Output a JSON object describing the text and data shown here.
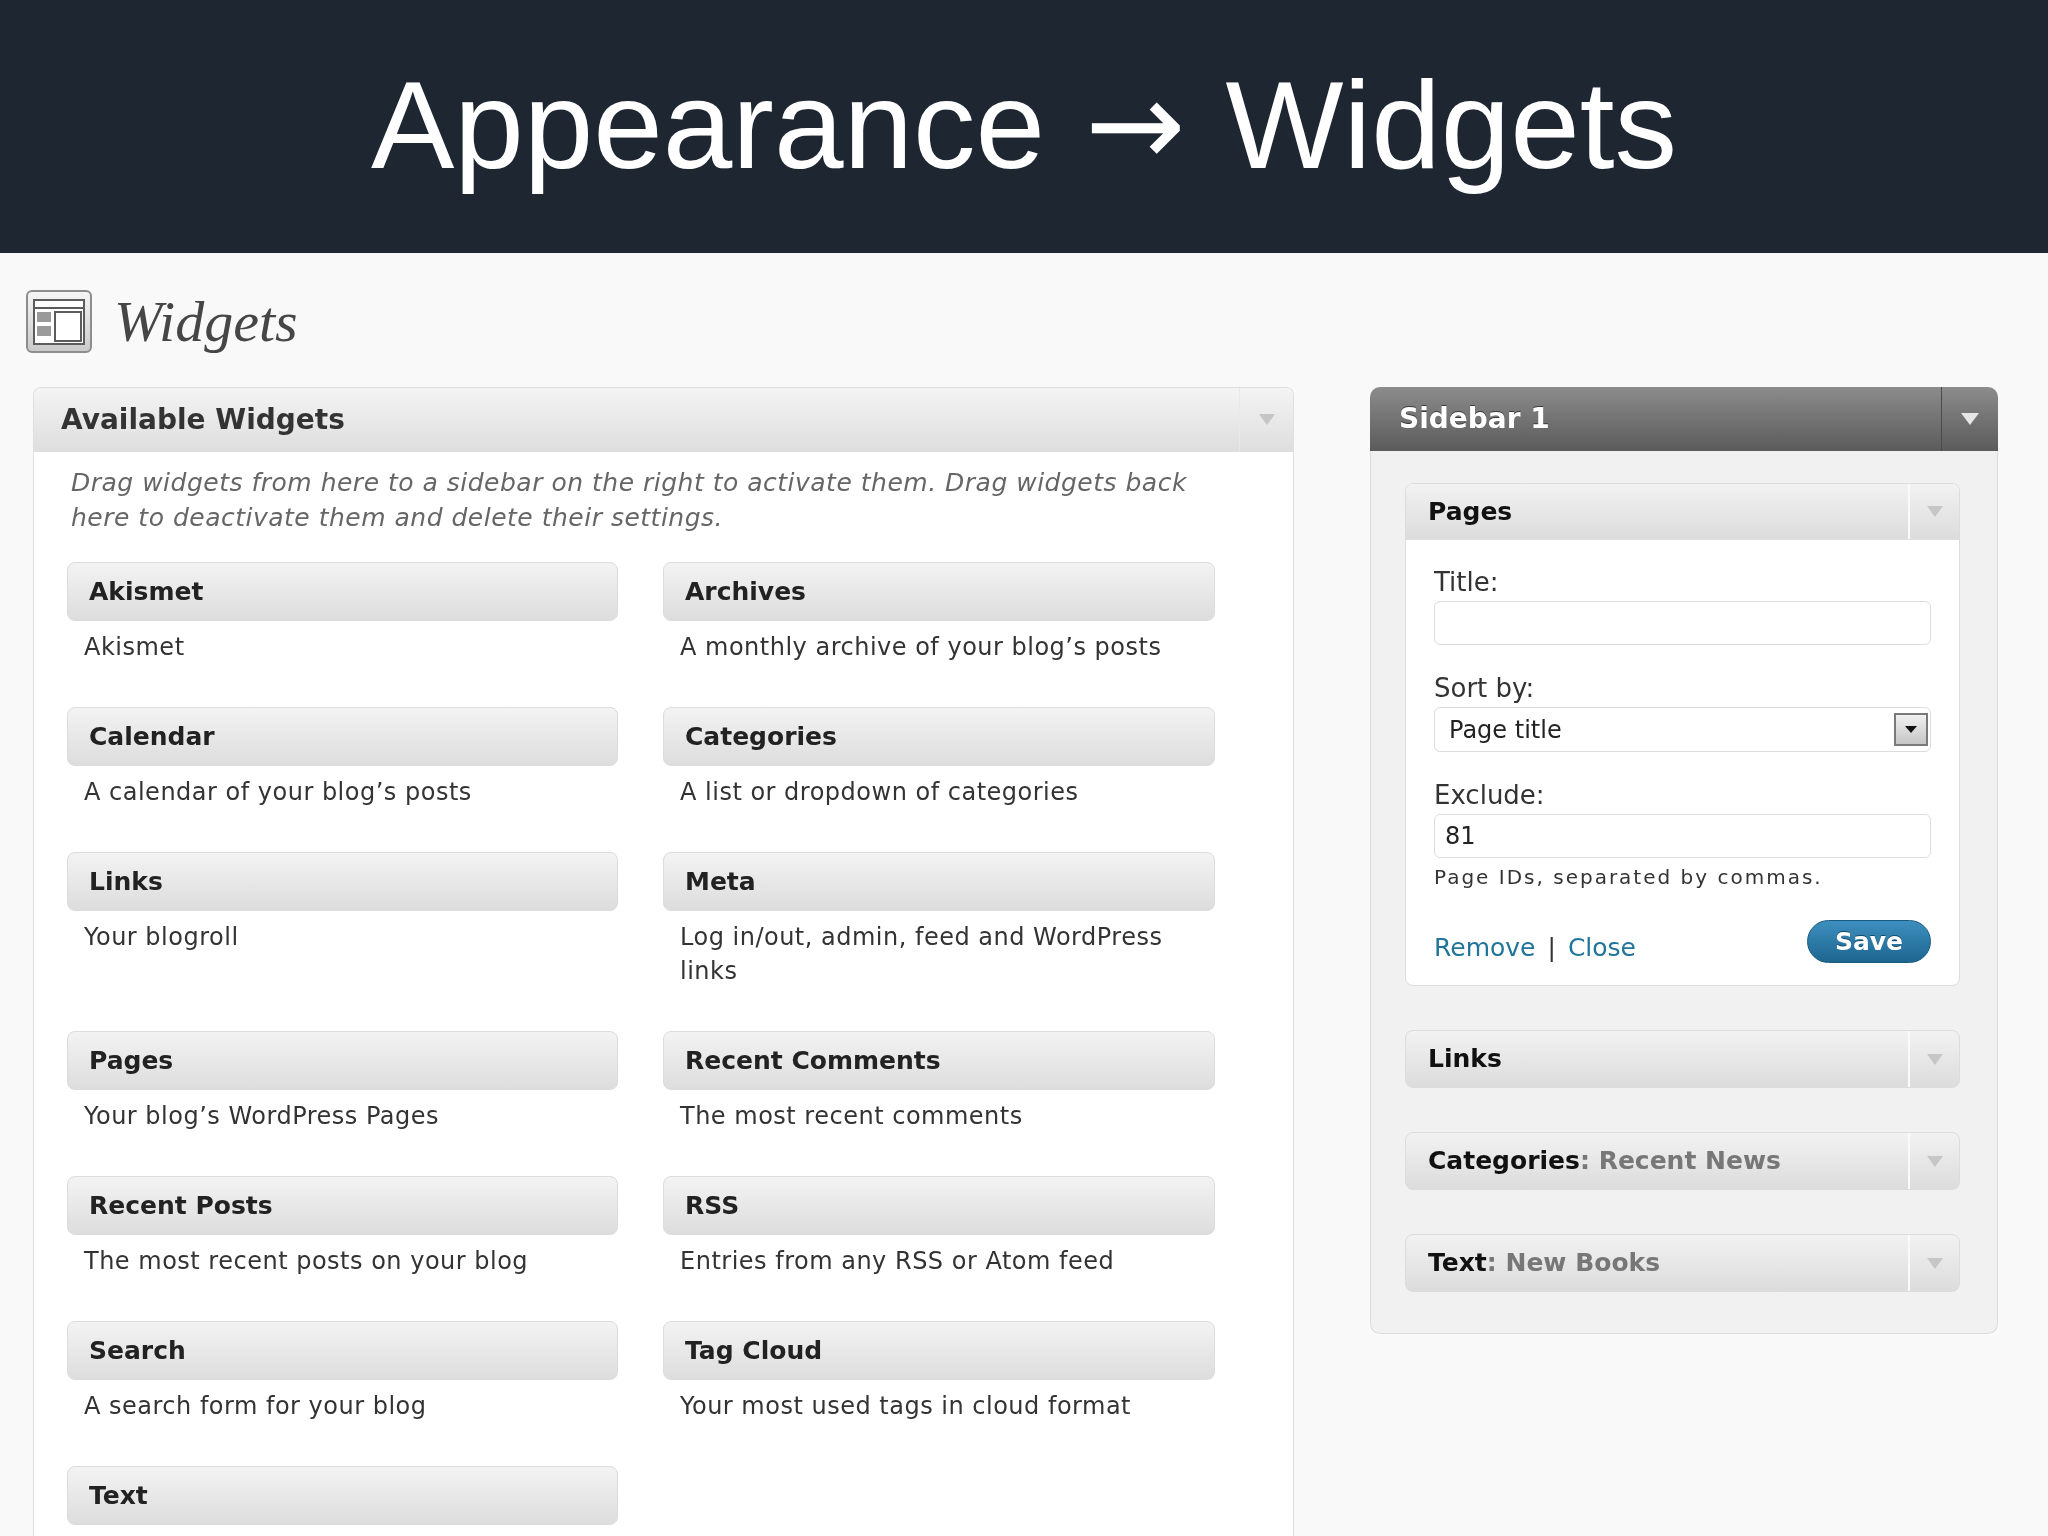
{
  "slide_title": {
    "section": "Appearance",
    "separator": "→",
    "page": "Widgets"
  },
  "page_title": "Widgets",
  "available_widgets": {
    "title": "Available Widgets",
    "description": "Drag widgets from here to a sidebar on the right to activate them. Drag widgets back here to deactivate them and delete their settings.",
    "widgets": [
      {
        "name": "Akismet",
        "description": "Akismet"
      },
      {
        "name": "Archives",
        "description": "A monthly archive of your blog’s posts"
      },
      {
        "name": "Calendar",
        "description": "A calendar of your blog’s posts"
      },
      {
        "name": "Categories",
        "description": "A list or dropdown of categories"
      },
      {
        "name": "Links",
        "description": "Your blogroll"
      },
      {
        "name": "Meta",
        "description": "Log in/out, admin, feed and WordPress links"
      },
      {
        "name": "Pages",
        "description": "Your blog’s WordPress Pages"
      },
      {
        "name": "Recent Comments",
        "description": "The most recent comments"
      },
      {
        "name": "Recent Posts",
        "description": "The most recent posts on your blog"
      },
      {
        "name": "RSS",
        "description": "Entries from any RSS or Atom feed"
      },
      {
        "name": "Search",
        "description": "A search form for your blog"
      },
      {
        "name": "Tag Cloud",
        "description": "Your most used tags in cloud format"
      },
      {
        "name": "Text"
      }
    ]
  },
  "sidebar": {
    "title": "Sidebar 1",
    "widgets": [
      {
        "title": "Pages",
        "expanded": true,
        "form": {
          "fields": [
            {
              "kind": "text",
              "label": "Title:"
            },
            {
              "kind": "select",
              "label": "Sort by:",
              "value": "Page title"
            },
            {
              "kind": "text",
              "label": "Exclude:",
              "value": "81",
              "hint": "Page IDs, separated by commas."
            }
          ],
          "links": [
            "Remove",
            "Close"
          ],
          "separator": "|",
          "button": "Save"
        }
      },
      {
        "title": "Links",
        "expanded": false
      },
      {
        "title": "Categories",
        "in_widget_title": ": Recent News",
        "expanded": false
      },
      {
        "title": "Text",
        "in_widget_title": ": New Books",
        "expanded": false
      }
    ]
  }
}
